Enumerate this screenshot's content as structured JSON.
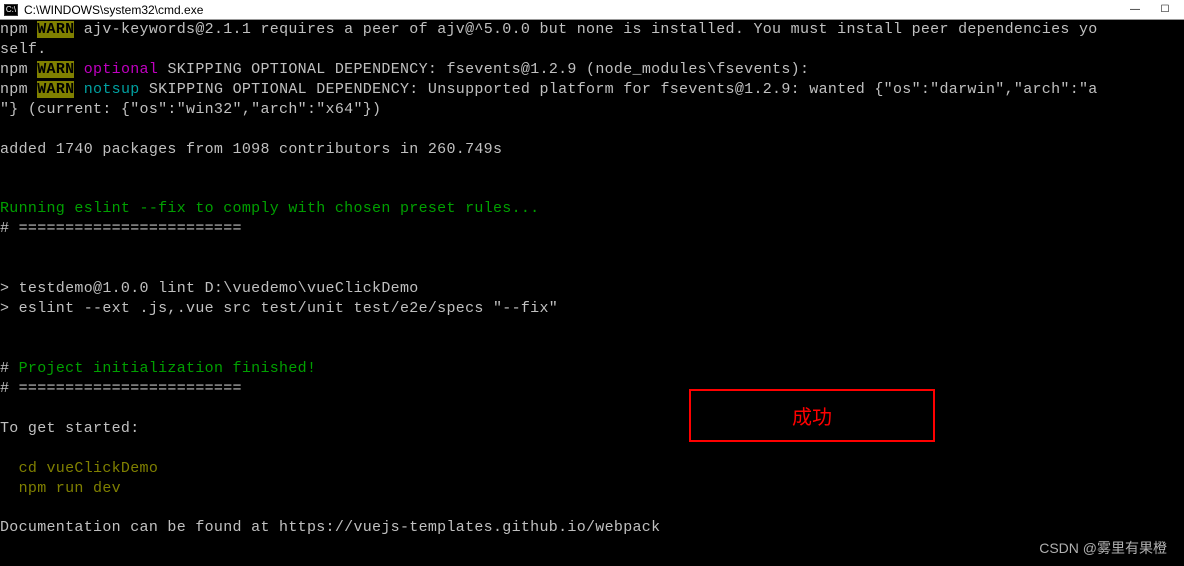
{
  "window": {
    "title": "C:\\WINDOWS\\system32\\cmd.exe",
    "icon_label": "C:\\"
  },
  "lines": {
    "l1_npm": "npm ",
    "l1_warn": "WARN",
    "l1_rest": " ajv-keywords@2.1.1 requires a peer of ajv@^5.0.0 but none is installed. You must install peer dependencies yo",
    "l2": "self.",
    "l3_npm": "npm ",
    "l3_warn": "WARN",
    "l3_opt": " optional",
    "l3_rest": " SKIPPING OPTIONAL DEPENDENCY: fsevents@1.2.9 (node_modules\\fsevents):",
    "l4_npm": "npm ",
    "l4_warn": "WARN",
    "l4_ns": " notsup",
    "l4_rest": " SKIPPING OPTIONAL DEPENDENCY: Unsupported platform for fsevents@1.2.9: wanted {\"os\":\"darwin\",\"arch\":\"a",
    "l5": "\"} (current: {\"os\":\"win32\",\"arch\":\"x64\"})",
    "l6_blank": "",
    "l7": "added 1740 packages from 1098 contributors in 260.749s",
    "l8_blank": "",
    "l9_blank": "",
    "l10": "Running eslint --fix to comply with chosen preset rules...",
    "l11": "# ========================",
    "l12_blank": "",
    "l13_blank": "",
    "l14": "> testdemo@1.0.0 lint D:\\vuedemo\\vueClickDemo",
    "l15": "> eslint --ext .js,.vue src test/unit test/e2e/specs \"--fix\"",
    "l16_blank": "",
    "l17_blank": "",
    "l18_hash": "# ",
    "l18_msg": "Project initialization finished!",
    "l19": "# ========================",
    "l20_blank": "",
    "l21": "To get started:",
    "l22_blank": "",
    "l23": "  cd vueClickDemo",
    "l24": "  npm run dev",
    "l25_blank": "",
    "l26": "Documentation can be found at https://vuejs-templates.github.io/webpack"
  },
  "annotation": {
    "label": "成功"
  },
  "watermark": {
    "text": "CSDN @雾里有果橙"
  }
}
